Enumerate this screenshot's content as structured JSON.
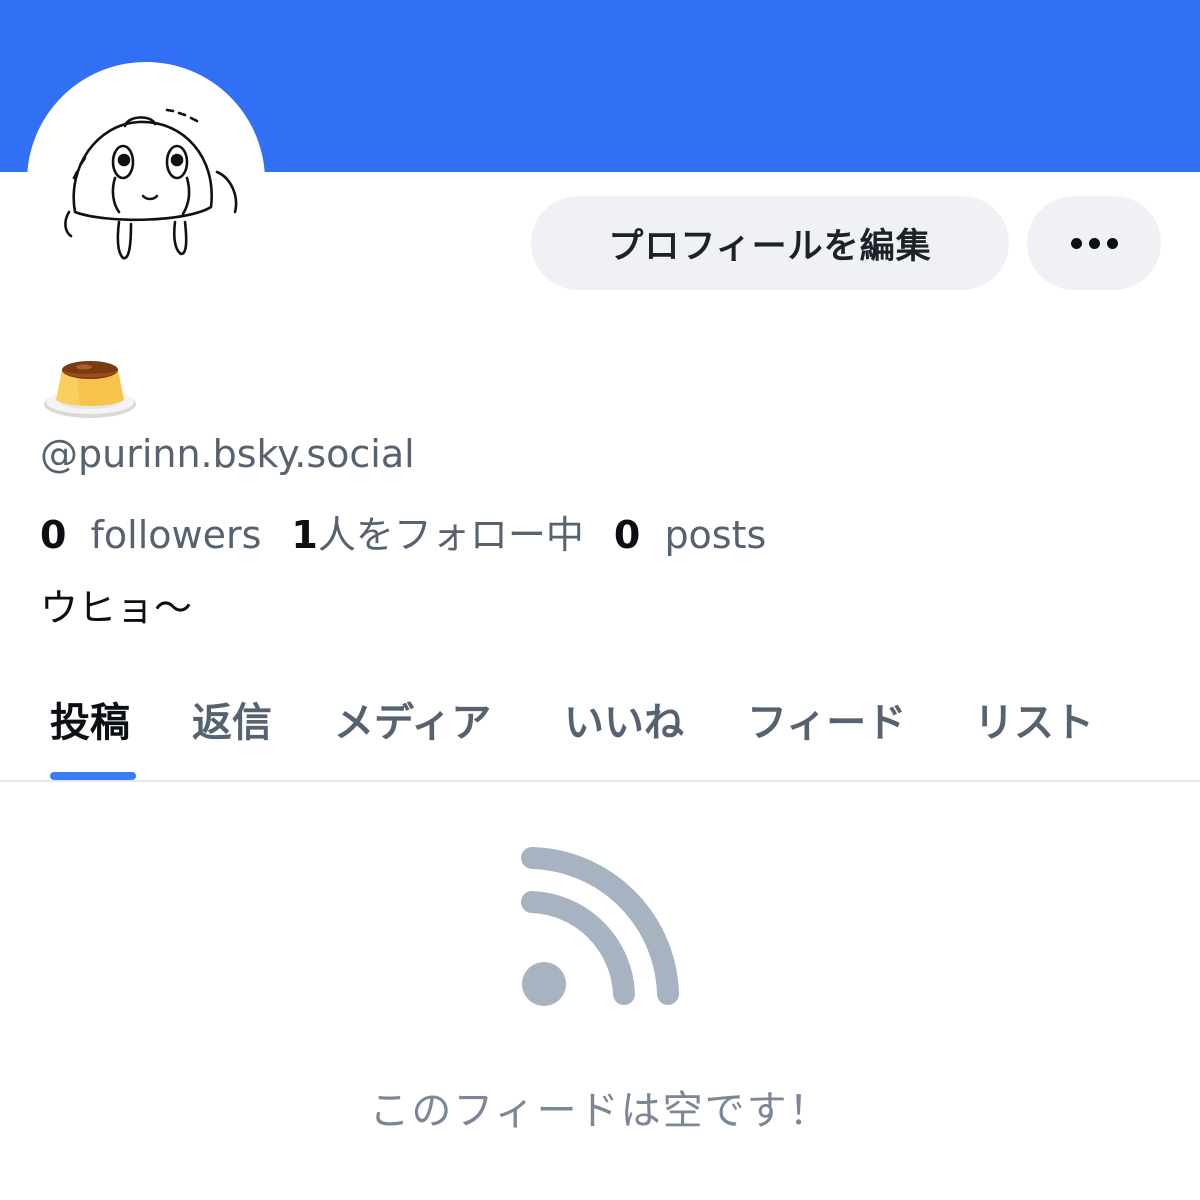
{
  "colors": {
    "banner": "#316ff4",
    "accent": "#3a7df3",
    "button_bg": "#eff1f5",
    "muted_text": "#56626f",
    "empty_icon": "#a8b3c2"
  },
  "profile": {
    "avatar_icon": "jellyfish-drawing-avatar",
    "display_name_icon": "pudding-emoji",
    "handle": "@purinn.bsky.social",
    "stats": {
      "followers_count": "0",
      "followers_label": "followers",
      "following_count": "1",
      "following_label": "人をフォロー中",
      "posts_count": "0",
      "posts_label": "posts"
    },
    "bio": "ウヒョ〜"
  },
  "actions": {
    "edit_profile_label": "プロフィールを編集",
    "more_icon": "ellipsis-icon"
  },
  "tabs": [
    {
      "label": "投稿",
      "active": true
    },
    {
      "label": "返信",
      "active": false
    },
    {
      "label": "メディア",
      "active": false
    },
    {
      "label": "いいね",
      "active": false
    },
    {
      "label": "フィード",
      "active": false
    },
    {
      "label": "リスト",
      "active": false
    }
  ],
  "feed": {
    "empty_icon": "rss-feed-icon",
    "empty_message": "このフィードは空です！"
  }
}
